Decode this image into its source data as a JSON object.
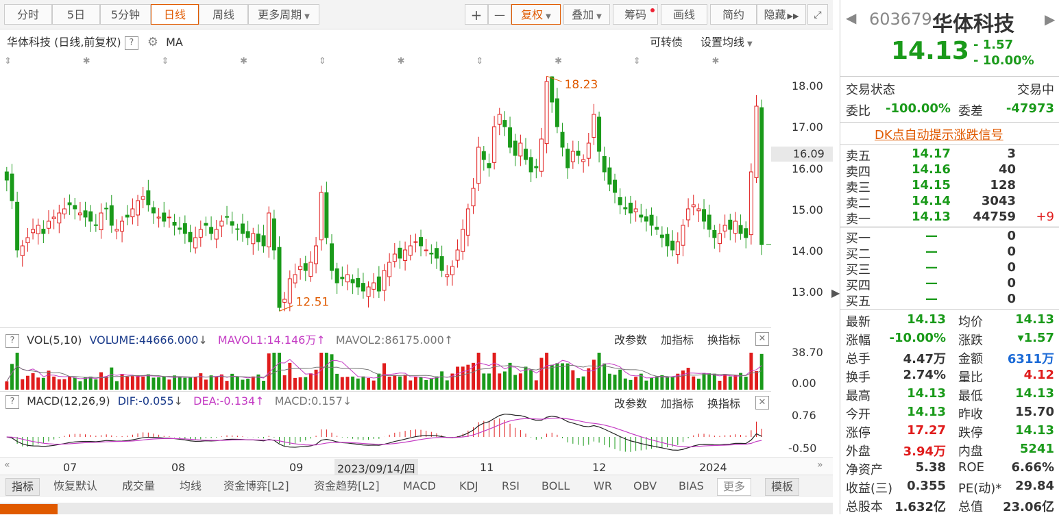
{
  "toolbar": {
    "periods": [
      "分时",
      "5日",
      "5分钟",
      "日线",
      "周线",
      "更多周期"
    ],
    "active_period": "日线",
    "plus": "+",
    "minus": "—",
    "fuquan": "复权",
    "overlay": "叠加",
    "chips": "筹码",
    "draw": "画线",
    "simple": "简约",
    "hide": "隐藏",
    "fullscreen_icon": "fullscreen-icon"
  },
  "kline": {
    "title": "华体科技 (日线,前复权)",
    "help": "?",
    "ma": "MA",
    "convertible": "可转债",
    "set_ma": "设置均线",
    "high_label": "18.23",
    "low_label": "12.51",
    "price_ticks": [
      "18.00",
      "17.00",
      "16.00",
      "15.00",
      "14.00",
      "13.00"
    ],
    "current_price_tag": "16.09"
  },
  "vol": {
    "help": "?",
    "label": "VOL(5,10)",
    "volume": "VOLUME:44666.000",
    "mavol1": "MAVOL1:14.146万",
    "mavol2": "MAVOL2:86175.000",
    "edit": "改参数",
    "add": "加指标",
    "switch": "换指标",
    "close": "✕",
    "ticks": [
      "38.70",
      "0.00"
    ]
  },
  "macd": {
    "help": "?",
    "label": "MACD(12,26,9)",
    "dif": "DIF:-0.055",
    "dea": "DEA:-0.134",
    "macd": "MACD:0.157",
    "edit": "改参数",
    "add": "加指标",
    "switch": "换指标",
    "close": "✕",
    "ticks": [
      "0.76",
      "-0.50"
    ]
  },
  "time_axis": {
    "labels": [
      "07",
      "08",
      "09",
      "2023/09/14/四",
      "11",
      "12",
      "2024"
    ]
  },
  "indicator_tabs": [
    "指标",
    "恢复默认",
    "成交量",
    "均线",
    "资金博弈[L2]",
    "资金趋势[L2]",
    "MACD",
    "KDJ",
    "RSI",
    "BOLL",
    "WR",
    "OBV",
    "BIAS",
    "更多",
    "模板"
  ],
  "stock": {
    "code": "603679",
    "name": "华体科技",
    "price": "14.13",
    "change": "- 1.57",
    "change_pct": "- 10.00%",
    "status_label": "交易状态",
    "status": "交易中",
    "weibi_label": "委比",
    "weibi": "-100.00%",
    "weicha_label": "委差",
    "weicha": "-47973",
    "dk_signal": "DK点自动提示涨跌信号",
    "sells": [
      {
        "label": "卖五",
        "price": "14.17",
        "vol": "3",
        "chg": ""
      },
      {
        "label": "卖四",
        "price": "14.16",
        "vol": "40",
        "chg": ""
      },
      {
        "label": "卖三",
        "price": "14.15",
        "vol": "128",
        "chg": ""
      },
      {
        "label": "卖二",
        "price": "14.14",
        "vol": "3043",
        "chg": ""
      },
      {
        "label": "卖一",
        "price": "14.13",
        "vol": "44759",
        "chg": "+9"
      }
    ],
    "buys": [
      {
        "label": "买一",
        "price": "—",
        "vol": "0"
      },
      {
        "label": "买二",
        "price": "—",
        "vol": "0"
      },
      {
        "label": "买三",
        "price": "—",
        "vol": "0"
      },
      {
        "label": "买四",
        "price": "—",
        "vol": "0"
      },
      {
        "label": "买五",
        "price": "—",
        "vol": "0"
      }
    ],
    "stats": [
      {
        "l1": "最新",
        "v1": "14.13",
        "c1": "green",
        "l2": "均价",
        "v2": "14.13",
        "c2": "green"
      },
      {
        "l1": "涨幅",
        "v1": "-10.00%",
        "c1": "green",
        "l2": "涨跌",
        "v2": "▾1.57",
        "c2": "green"
      },
      {
        "l1": "总手",
        "v1": "4.47万",
        "c1": "",
        "l2": "金额",
        "v2": "6311万",
        "c2": "blue"
      },
      {
        "l1": "换手",
        "v1": "2.74%",
        "c1": "",
        "l2": "量比",
        "v2": "4.12",
        "c2": "red"
      },
      {
        "l1": "最高",
        "v1": "14.13",
        "c1": "green",
        "l2": "最低",
        "v2": "14.13",
        "c2": "green"
      },
      {
        "l1": "今开",
        "v1": "14.13",
        "c1": "green",
        "l2": "昨收",
        "v2": "15.70",
        "c2": ""
      },
      {
        "l1": "涨停",
        "v1": "17.27",
        "c1": "red",
        "l2": "跌停",
        "v2": "14.13",
        "c2": "green"
      },
      {
        "l1": "外盘",
        "v1": "3.94万",
        "c1": "red",
        "l2": "内盘",
        "v2": "5241",
        "c2": "green"
      },
      {
        "l1": "净资产",
        "v1": "5.38",
        "c1": "",
        "l2": "ROE",
        "v2": "6.66%",
        "c2": ""
      },
      {
        "l1": "收益(三)",
        "v1": "0.355",
        "c1": "",
        "l2": "PE(动)*",
        "v2": "29.84",
        "c2": ""
      },
      {
        "l1": "总股本",
        "v1": "1.632亿",
        "c1": "",
        "l2": "总值",
        "v2": "23.06亿",
        "c2": ""
      }
    ]
  },
  "colors": {
    "up": "#e01c1c",
    "down": "#1a9a1a",
    "accent": "#e05a00",
    "mavol1": "#c43cc4",
    "mavol2": "#777777"
  },
  "chart_data": {
    "type": "candlestick",
    "closes": [
      15.7,
      15.2,
      14.0,
      14.1,
      14.3,
      14.5,
      14.6,
      14.4,
      14.7,
      14.8,
      14.9,
      15.0,
      15.1,
      15.0,
      14.9,
      14.8,
      14.7,
      14.6,
      14.9,
      15.0,
      14.6,
      14.5,
      14.7,
      14.8,
      15.0,
      15.2,
      15.3,
      15.1,
      14.9,
      14.8,
      14.7,
      14.8,
      14.6,
      14.5,
      14.4,
      14.2,
      14.3,
      14.5,
      14.6,
      14.4,
      14.5,
      14.7,
      14.8,
      14.6,
      14.5,
      14.4,
      14.3,
      14.4,
      14.2,
      14.1,
      14.9,
      14.0,
      12.6,
      12.8,
      13.3,
      13.4,
      13.6,
      13.5,
      13.7,
      14.1,
      15.4,
      14.3,
      13.5,
      13.2,
      13.3,
      13.4,
      13.2,
      13.1,
      13.0,
      13.1,
      13.2,
      13.0,
      13.5,
      13.7,
      13.9,
      13.8,
      14.0,
      14.1,
      14.2,
      14.1,
      14.0,
      13.9,
      13.8,
      13.5,
      13.4,
      13.6,
      14.0,
      14.5,
      15.0,
      15.5,
      16.5,
      16.2,
      16.0,
      17.0,
      17.3,
      17.0,
      16.5,
      16.3,
      16.6,
      16.2,
      15.9,
      16.0,
      16.7,
      18.1,
      17.6,
      17.0,
      16.5,
      16.0,
      16.4,
      16.3,
      16.2,
      16.6,
      17.3,
      16.4,
      15.9,
      15.6,
      15.4,
      15.1,
      15.0,
      14.9,
      15.0,
      14.8,
      14.7,
      14.6,
      14.5,
      14.3,
      14.1,
      14.0,
      14.2,
      14.6,
      15.0,
      15.1,
      15.0,
      14.7,
      14.5,
      14.3,
      14.4,
      14.6,
      14.5,
      14.7,
      14.4,
      14.3,
      15.9,
      17.5,
      14.13
    ],
    "y_range": [
      12.3,
      18.5
    ],
    "price_ticks": [
      18.0,
      17.0,
      16.0,
      15.0,
      14.0,
      13.0
    ],
    "high": 18.23,
    "low": 12.51
  }
}
